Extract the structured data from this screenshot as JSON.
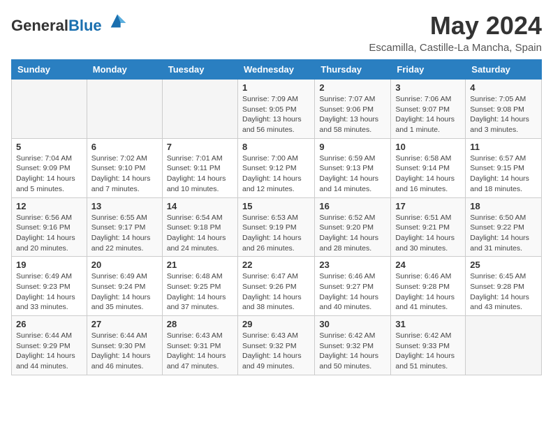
{
  "header": {
    "logo_general": "General",
    "logo_blue": "Blue",
    "month_year": "May 2024",
    "location": "Escamilla, Castille-La Mancha, Spain"
  },
  "weekdays": [
    "Sunday",
    "Monday",
    "Tuesday",
    "Wednesday",
    "Thursday",
    "Friday",
    "Saturday"
  ],
  "weeks": [
    [
      {
        "day": "",
        "sunrise": "",
        "sunset": "",
        "daylight": ""
      },
      {
        "day": "",
        "sunrise": "",
        "sunset": "",
        "daylight": ""
      },
      {
        "day": "",
        "sunrise": "",
        "sunset": "",
        "daylight": ""
      },
      {
        "day": "1",
        "sunrise": "Sunrise: 7:09 AM",
        "sunset": "Sunset: 9:05 PM",
        "daylight": "Daylight: 13 hours and 56 minutes."
      },
      {
        "day": "2",
        "sunrise": "Sunrise: 7:07 AM",
        "sunset": "Sunset: 9:06 PM",
        "daylight": "Daylight: 13 hours and 58 minutes."
      },
      {
        "day": "3",
        "sunrise": "Sunrise: 7:06 AM",
        "sunset": "Sunset: 9:07 PM",
        "daylight": "Daylight: 14 hours and 1 minute."
      },
      {
        "day": "4",
        "sunrise": "Sunrise: 7:05 AM",
        "sunset": "Sunset: 9:08 PM",
        "daylight": "Daylight: 14 hours and 3 minutes."
      }
    ],
    [
      {
        "day": "5",
        "sunrise": "Sunrise: 7:04 AM",
        "sunset": "Sunset: 9:09 PM",
        "daylight": "Daylight: 14 hours and 5 minutes."
      },
      {
        "day": "6",
        "sunrise": "Sunrise: 7:02 AM",
        "sunset": "Sunset: 9:10 PM",
        "daylight": "Daylight: 14 hours and 7 minutes."
      },
      {
        "day": "7",
        "sunrise": "Sunrise: 7:01 AM",
        "sunset": "Sunset: 9:11 PM",
        "daylight": "Daylight: 14 hours and 10 minutes."
      },
      {
        "day": "8",
        "sunrise": "Sunrise: 7:00 AM",
        "sunset": "Sunset: 9:12 PM",
        "daylight": "Daylight: 14 hours and 12 minutes."
      },
      {
        "day": "9",
        "sunrise": "Sunrise: 6:59 AM",
        "sunset": "Sunset: 9:13 PM",
        "daylight": "Daylight: 14 hours and 14 minutes."
      },
      {
        "day": "10",
        "sunrise": "Sunrise: 6:58 AM",
        "sunset": "Sunset: 9:14 PM",
        "daylight": "Daylight: 14 hours and 16 minutes."
      },
      {
        "day": "11",
        "sunrise": "Sunrise: 6:57 AM",
        "sunset": "Sunset: 9:15 PM",
        "daylight": "Daylight: 14 hours and 18 minutes."
      }
    ],
    [
      {
        "day": "12",
        "sunrise": "Sunrise: 6:56 AM",
        "sunset": "Sunset: 9:16 PM",
        "daylight": "Daylight: 14 hours and 20 minutes."
      },
      {
        "day": "13",
        "sunrise": "Sunrise: 6:55 AM",
        "sunset": "Sunset: 9:17 PM",
        "daylight": "Daylight: 14 hours and 22 minutes."
      },
      {
        "day": "14",
        "sunrise": "Sunrise: 6:54 AM",
        "sunset": "Sunset: 9:18 PM",
        "daylight": "Daylight: 14 hours and 24 minutes."
      },
      {
        "day": "15",
        "sunrise": "Sunrise: 6:53 AM",
        "sunset": "Sunset: 9:19 PM",
        "daylight": "Daylight: 14 hours and 26 minutes."
      },
      {
        "day": "16",
        "sunrise": "Sunrise: 6:52 AM",
        "sunset": "Sunset: 9:20 PM",
        "daylight": "Daylight: 14 hours and 28 minutes."
      },
      {
        "day": "17",
        "sunrise": "Sunrise: 6:51 AM",
        "sunset": "Sunset: 9:21 PM",
        "daylight": "Daylight: 14 hours and 30 minutes."
      },
      {
        "day": "18",
        "sunrise": "Sunrise: 6:50 AM",
        "sunset": "Sunset: 9:22 PM",
        "daylight": "Daylight: 14 hours and 31 minutes."
      }
    ],
    [
      {
        "day": "19",
        "sunrise": "Sunrise: 6:49 AM",
        "sunset": "Sunset: 9:23 PM",
        "daylight": "Daylight: 14 hours and 33 minutes."
      },
      {
        "day": "20",
        "sunrise": "Sunrise: 6:49 AM",
        "sunset": "Sunset: 9:24 PM",
        "daylight": "Daylight: 14 hours and 35 minutes."
      },
      {
        "day": "21",
        "sunrise": "Sunrise: 6:48 AM",
        "sunset": "Sunset: 9:25 PM",
        "daylight": "Daylight: 14 hours and 37 minutes."
      },
      {
        "day": "22",
        "sunrise": "Sunrise: 6:47 AM",
        "sunset": "Sunset: 9:26 PM",
        "daylight": "Daylight: 14 hours and 38 minutes."
      },
      {
        "day": "23",
        "sunrise": "Sunrise: 6:46 AM",
        "sunset": "Sunset: 9:27 PM",
        "daylight": "Daylight: 14 hours and 40 minutes."
      },
      {
        "day": "24",
        "sunrise": "Sunrise: 6:46 AM",
        "sunset": "Sunset: 9:28 PM",
        "daylight": "Daylight: 14 hours and 41 minutes."
      },
      {
        "day": "25",
        "sunrise": "Sunrise: 6:45 AM",
        "sunset": "Sunset: 9:28 PM",
        "daylight": "Daylight: 14 hours and 43 minutes."
      }
    ],
    [
      {
        "day": "26",
        "sunrise": "Sunrise: 6:44 AM",
        "sunset": "Sunset: 9:29 PM",
        "daylight": "Daylight: 14 hours and 44 minutes."
      },
      {
        "day": "27",
        "sunrise": "Sunrise: 6:44 AM",
        "sunset": "Sunset: 9:30 PM",
        "daylight": "Daylight: 14 hours and 46 minutes."
      },
      {
        "day": "28",
        "sunrise": "Sunrise: 6:43 AM",
        "sunset": "Sunset: 9:31 PM",
        "daylight": "Daylight: 14 hours and 47 minutes."
      },
      {
        "day": "29",
        "sunrise": "Sunrise: 6:43 AM",
        "sunset": "Sunset: 9:32 PM",
        "daylight": "Daylight: 14 hours and 49 minutes."
      },
      {
        "day": "30",
        "sunrise": "Sunrise: 6:42 AM",
        "sunset": "Sunset: 9:32 PM",
        "daylight": "Daylight: 14 hours and 50 minutes."
      },
      {
        "day": "31",
        "sunrise": "Sunrise: 6:42 AM",
        "sunset": "Sunset: 9:33 PM",
        "daylight": "Daylight: 14 hours and 51 minutes."
      },
      {
        "day": "",
        "sunrise": "",
        "sunset": "",
        "daylight": ""
      }
    ]
  ]
}
